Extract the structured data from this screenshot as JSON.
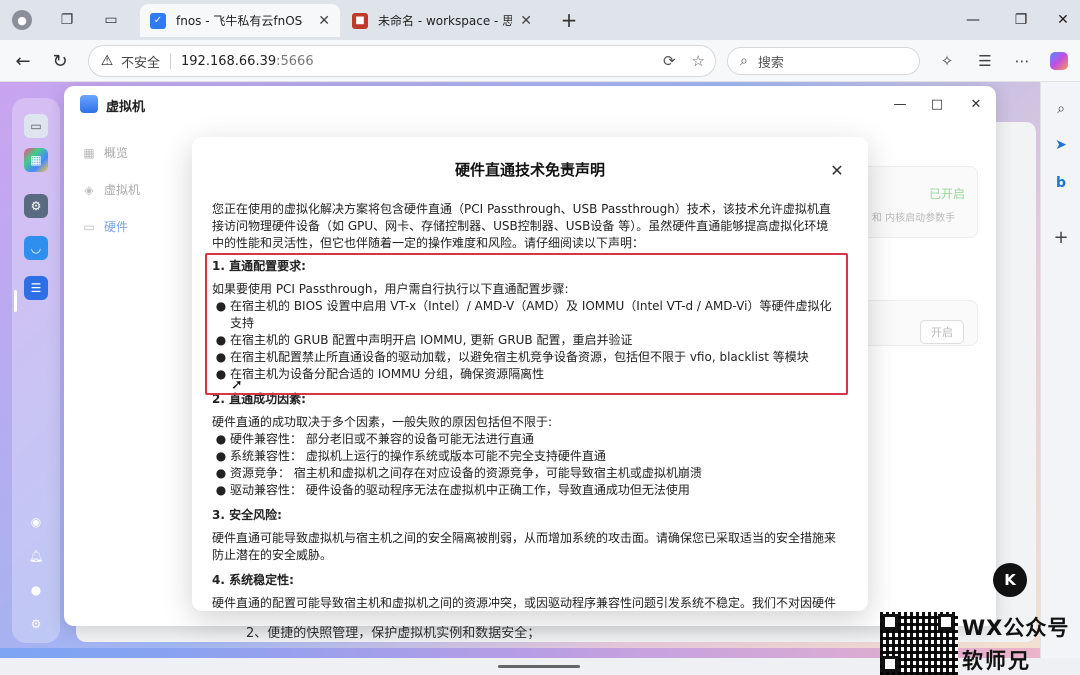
{
  "browser": {
    "tabs": [
      {
        "title": "fnos - 飞牛私有云fnOS",
        "active": true
      },
      {
        "title": "未命名 - workspace - 思源笔",
        "active": false
      }
    ],
    "address": {
      "security_label": "不安全",
      "host": "192.168.66.39",
      "port": ":5666"
    },
    "search_placeholder": "搜索"
  },
  "vm_window": {
    "title": "虚拟机",
    "nav": [
      {
        "label": "概览",
        "icon": "grid-icon"
      },
      {
        "label": "虚拟机",
        "icon": "cube-icon"
      },
      {
        "label": "硬件",
        "icon": "disk-icon"
      }
    ],
    "bg_status": "已开启",
    "bg_hint": "和 内核启动参数手",
    "bg_button": "开启"
  },
  "modal": {
    "title": "硬件直通技术免责声明",
    "intro": "您正在使用的虚拟化解决方案将包含硬件直通（PCI Passthrough、USB Passthrough）技术，该技术允许虚拟机直接访问物理硬件设备（如 GPU、网卡、存储控制器、USB控制器、USB设备 等）。虽然硬件直通能够提高虚拟化环境中的性能和灵活性，但它也伴随着一定的操作难度和风险。请仔细阅读以下声明：",
    "sections": [
      {
        "heading": "1. 直通配置要求:",
        "lead": "如果要使用 PCI Passthrough，用户需自行执行以下直通配置步骤:",
        "bullets": [
          "在宿主机的 BIOS 设置中启用 VT-x（Intel）/ AMD-V（AMD）及 IOMMU（Intel VT-d / AMD-Vi）等硬件虚拟化支持",
          "在宿主机的 GRUB 配置中声明开启 IOMMU, 更新 GRUB 配置，重启并验证",
          "在宿主机配置禁止所直通设备的驱动加载，以避免宿主机竞争设备资源，包括但不限于 vfio, blacklist 等模块",
          "在宿主机为设备分配合适的 IOMMU 分组，确保资源隔离性"
        ]
      },
      {
        "heading": "2. 直通成功因素:",
        "lead": "硬件直通的成功取决于多个因素，一般失败的原因包括但不限于:",
        "bullets": [
          "硬件兼容性：  部分老旧或不兼容的设备可能无法进行直通",
          "系统兼容性：  虚拟机上运行的操作系统或版本可能不完全支持硬件直通",
          "资源竞争：  宿主机和虚拟机之间存在对应设备的资源竞争，可能导致宿主机或虚拟机崩溃",
          "驱动兼容性：  硬件设备的驱动程序无法在虚拟机中正确工作，导致直通成功但无法使用"
        ]
      },
      {
        "heading": "3. 安全风险:",
        "lead": "硬件直通可能导致虚拟机与宿主机之间的安全隔离被削弱，从而增加系统的攻击面。请确保您已采取适当的安全措施来防止潜在的安全威胁。",
        "bullets": []
      },
      {
        "heading": "4. 系统稳定性:",
        "lead": "硬件直通的配置可能导致宿主机和虚拟机之间的资源冲突，或因驱动程序兼容性问题引发系统不稳定。我们不对因硬件",
        "bullets": []
      }
    ]
  },
  "background_text": "2、便捷的快照管理，保护虚拟机实例和数据安全；",
  "overlay": {
    "badge": "K",
    "wechat_label": "WX公众号",
    "wechat_name": "软师兄"
  },
  "colors": {
    "highlight": "#d7344a",
    "accent": "#2f6fe6"
  }
}
